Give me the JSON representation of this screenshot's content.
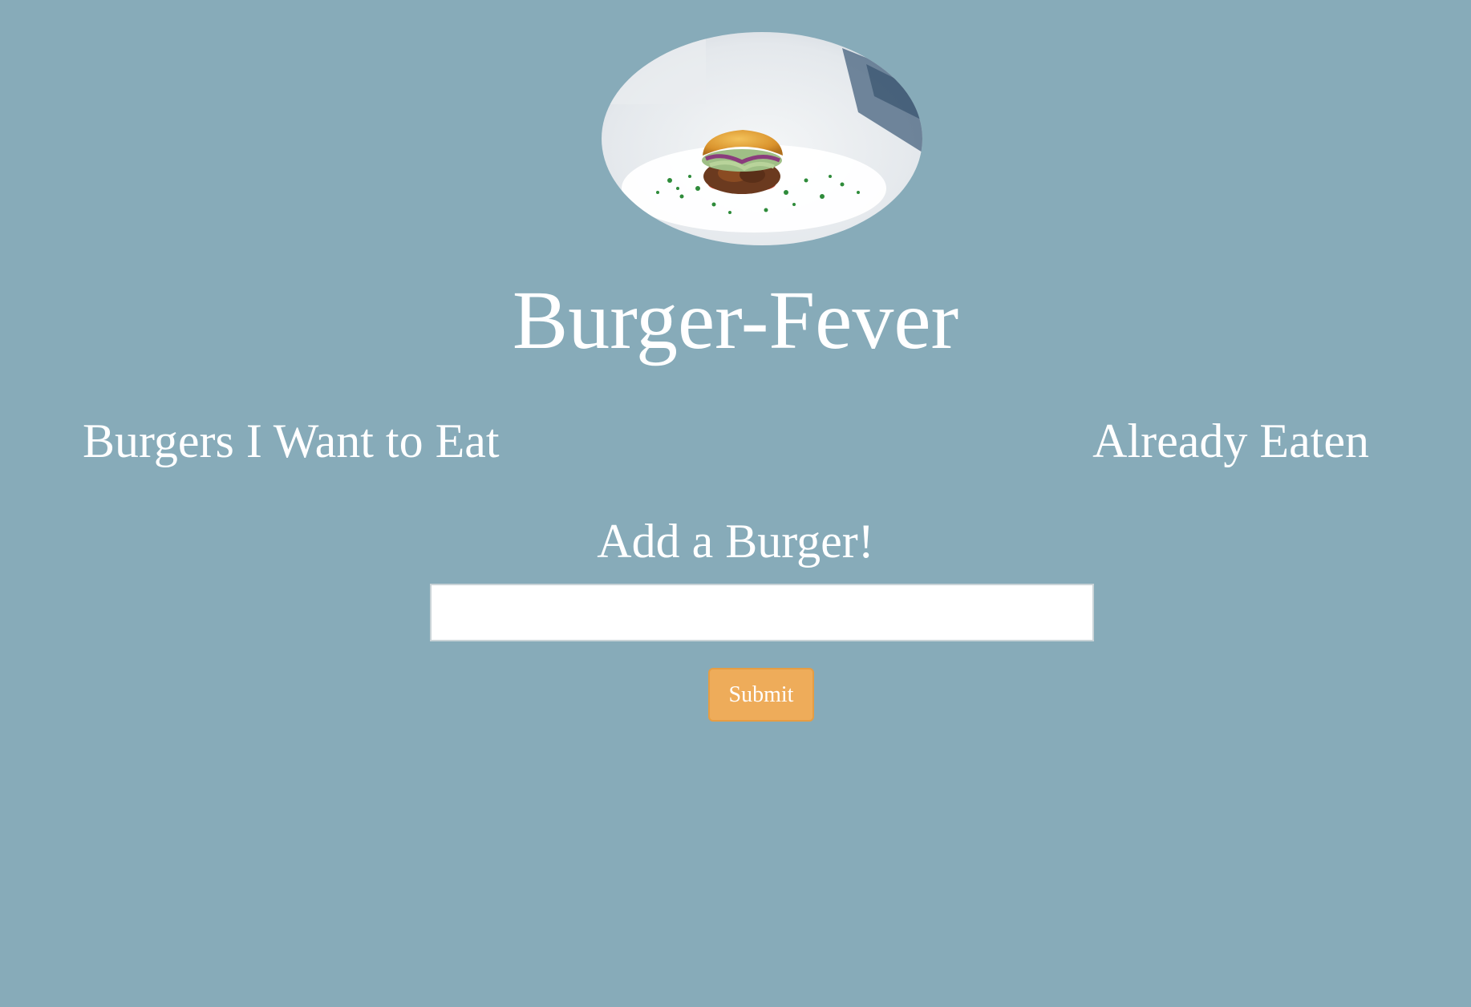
{
  "header": {
    "image_name": "burger-photo",
    "title": "Burger-Fever"
  },
  "columns": {
    "left_heading": "Burgers I Want to Eat",
    "right_heading": "Already Eaten"
  },
  "form": {
    "heading": "Add a Burger!",
    "input_value": "",
    "input_placeholder": "",
    "submit_label": "Submit"
  },
  "colors": {
    "background": "#87abb9",
    "text": "#ffffff",
    "button": "#eeac5a"
  }
}
